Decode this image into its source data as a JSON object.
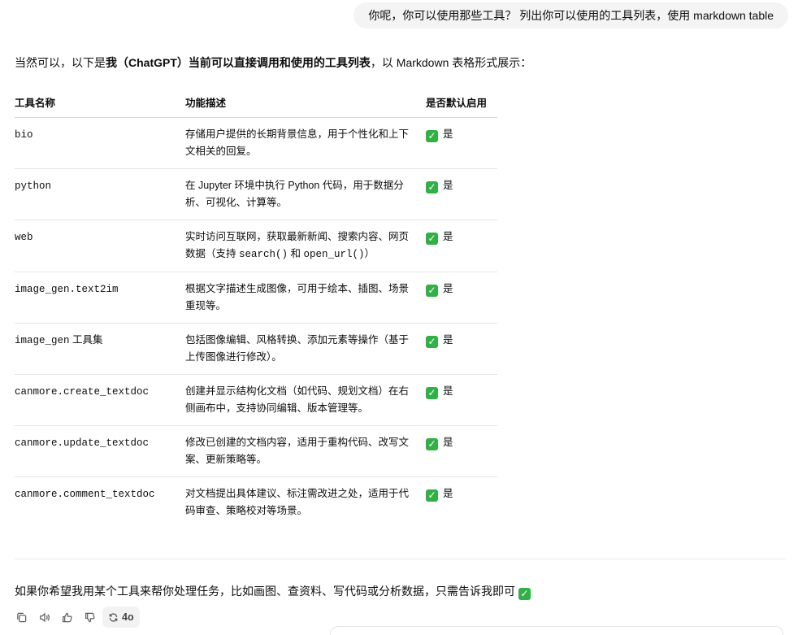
{
  "user_message": "你呢，你可以使用那些工具？ 列出你可以使用的工具列表，使用 markdown table",
  "intro": {
    "prefix": "当然可以，以下是",
    "bold": "我（ChatGPT）当前可以直接调用和使用的工具列表",
    "suffix": "，以 Markdown 表格形式展示："
  },
  "table": {
    "headers": [
      "工具名称",
      "功能描述",
      "是否默认启用"
    ],
    "rows": [
      {
        "name": "bio",
        "name_suffix": "",
        "desc": "存储用户提供的长期背景信息，用于个性化和上下文相关的回复。",
        "enabled": "是"
      },
      {
        "name": "python",
        "name_suffix": "",
        "desc": "在 Jupyter 环境中执行 Python 代码，用于数据分析、可视化、计算等。",
        "enabled": "是"
      },
      {
        "name": "web",
        "name_suffix": "",
        "desc_parts": [
          "实时访问互联网，获取最新新闻、搜索内容、网页数据（支持 ",
          "search()",
          " 和 ",
          "open_url()",
          "）"
        ],
        "enabled": "是"
      },
      {
        "name": "image_gen.text2im",
        "name_suffix": "",
        "desc": "根据文字描述生成图像，可用于绘本、插图、场景重现等。",
        "enabled": "是"
      },
      {
        "name": "image_gen",
        "name_suffix": " 工具集",
        "desc": "包括图像编辑、风格转换、添加元素等操作（基于上传图像进行修改）。",
        "enabled": "是"
      },
      {
        "name": "canmore.create_textdoc",
        "name_suffix": "",
        "desc": "创建并显示结构化文档（如代码、规划文档）在右侧画布中，支持协同编辑、版本管理等。",
        "enabled": "是"
      },
      {
        "name": "canmore.update_textdoc",
        "name_suffix": "",
        "desc": "修改已创建的文档内容，适用于重构代码、改写文案、更新策略等。",
        "enabled": "是"
      },
      {
        "name": "canmore.comment_textdoc",
        "name_suffix": "",
        "desc": "对文档提出具体建议、标注需改进之处，适用于代码审查、策略校对等场景。",
        "enabled": "是"
      }
    ]
  },
  "closing": "如果你希望我用某个工具来帮你处理任务，比如画图、查资料、写代码或分析数据，只需告诉我即可",
  "actions": {
    "icons": [
      "copy-icon",
      "speaker-icon",
      "thumbs-up-icon",
      "thumbs-down-icon"
    ],
    "model_label": "4o"
  },
  "colors": {
    "check_green": "#31b045",
    "bubble_bg": "#f4f4f4"
  }
}
